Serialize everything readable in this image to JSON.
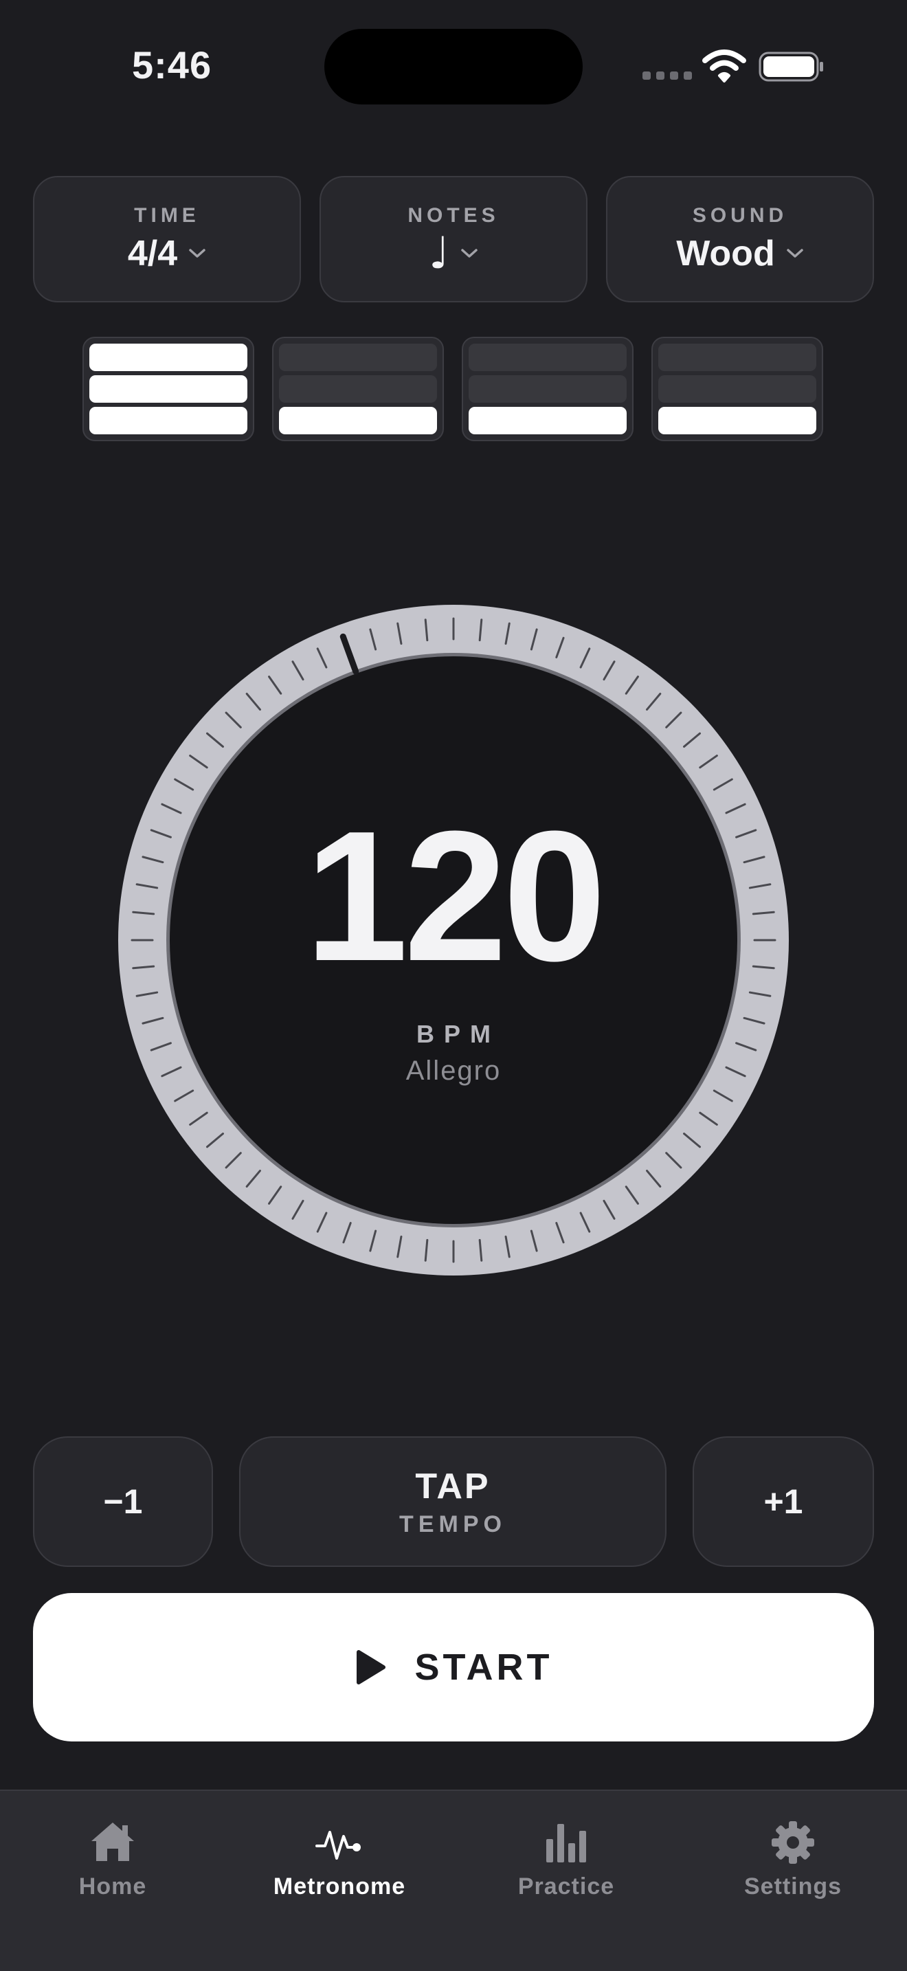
{
  "status": {
    "time": "5:46"
  },
  "top_cards": {
    "time": {
      "label": "TIME",
      "value": "4/4"
    },
    "notes": {
      "label": "NOTES",
      "value": "♩",
      "icon": "quarter-note-icon"
    },
    "sound": {
      "label": "SOUND",
      "value": "Wood"
    }
  },
  "beats": [
    {
      "level": 3,
      "max": 3
    },
    {
      "level": 1,
      "max": 3
    },
    {
      "level": 1,
      "max": 3
    },
    {
      "level": 1,
      "max": 3
    }
  ],
  "dial": {
    "value": 120,
    "unit": "BPM",
    "tempo_name": "Allegro",
    "min": 30,
    "max": 300
  },
  "controls": {
    "minus_label": "−1",
    "tap_label": "TAP",
    "tap_sub": "TEMPO",
    "plus_label": "+1",
    "start_label": "START"
  },
  "tabs": [
    {
      "label": "Home",
      "icon": "home-icon",
      "active": false
    },
    {
      "label": "Metronome",
      "icon": "pulse-icon",
      "active": true
    },
    {
      "label": "Practice",
      "icon": "bar-chart-icon",
      "active": false
    },
    {
      "label": "Settings",
      "icon": "gear-icon",
      "active": false
    }
  ],
  "colors": {
    "background": "#1c1c20",
    "card": "#27272c",
    "accent": "#ffffff",
    "dial_ring": "#c5c5cc"
  }
}
